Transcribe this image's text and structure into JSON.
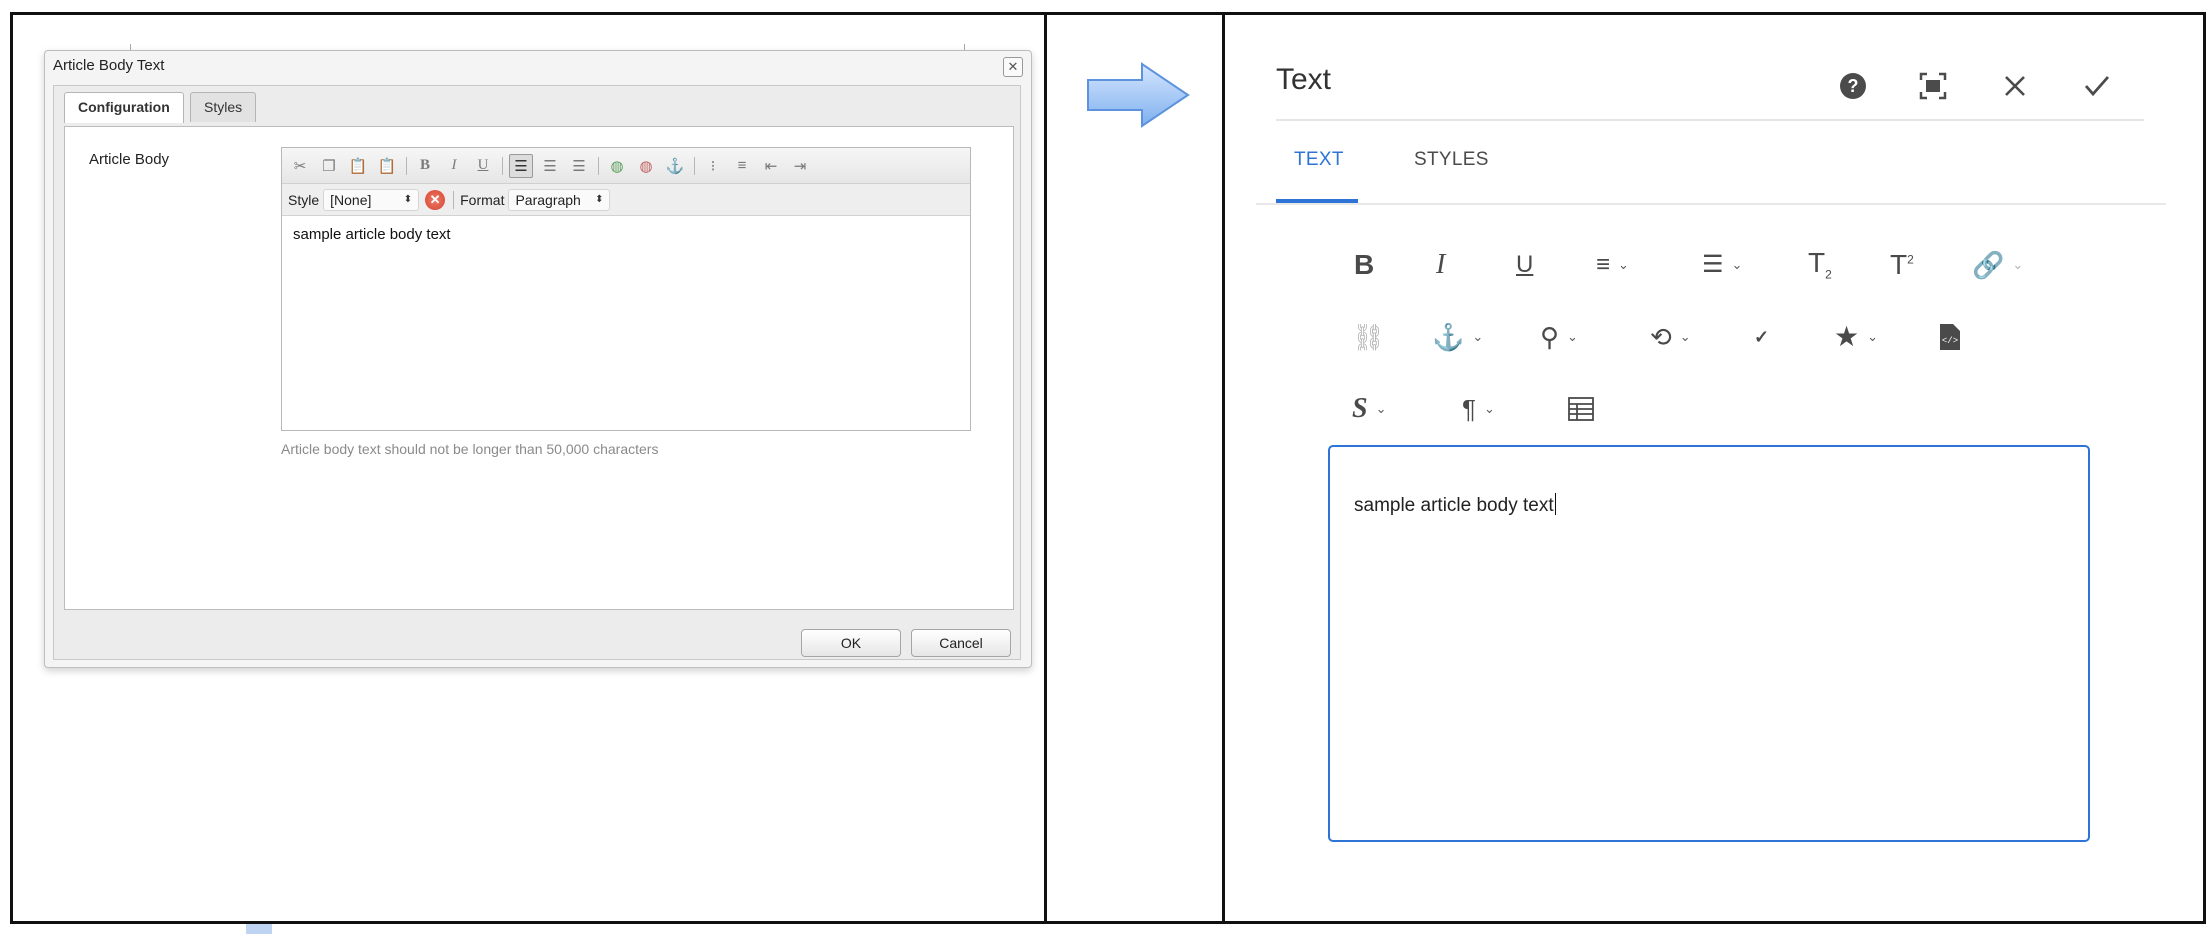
{
  "classic": {
    "title": "Article Body Text",
    "close_glyph": "✕",
    "tabs": [
      {
        "label": "Configuration"
      },
      {
        "label": "Styles"
      }
    ],
    "field_label": "Article Body",
    "toolbar_style_label": "Style",
    "toolbar_style_value": "[None]",
    "toolbar_format_label": "Format",
    "toolbar_format_value": "Paragraph",
    "editor_text": "sample article body text",
    "help_text": "Article body text should not be longer than 50,000 characters",
    "ok_label": "OK",
    "cancel_label": "Cancel"
  },
  "touch": {
    "title": "Text",
    "tabs": [
      {
        "label": "TEXT"
      },
      {
        "label": "STYLES"
      }
    ],
    "editor_text": "sample article body text",
    "accent_color": "#2d74d6"
  },
  "icons": {
    "classic_toolbar": [
      "cut-icon",
      "copy-icon",
      "paste-icon",
      "paste-text-icon",
      "bold-icon",
      "italic-icon",
      "underline-icon",
      "align-left-icon",
      "align-center-icon",
      "align-right-icon",
      "link-icon",
      "unlink-icon",
      "anchor-icon",
      "bullet-list-icon",
      "numbered-list-icon",
      "outdent-icon",
      "indent-icon"
    ],
    "touch_header": [
      "help-icon",
      "fullscreen-icon",
      "close-icon",
      "confirm-icon"
    ],
    "touch_toolbar": [
      "bold-icon",
      "italic-icon",
      "underline-icon",
      "justify-icon",
      "lists-icon",
      "subscript-icon",
      "superscript-icon",
      "link-icon",
      "unlink-icon",
      "anchor-icon",
      "find-icon",
      "find-replace-icon",
      "spellcheck-icon",
      "special-characters-icon",
      "source-edit-icon",
      "styles-icon",
      "paragraph-format-icon",
      "table-icon"
    ]
  }
}
